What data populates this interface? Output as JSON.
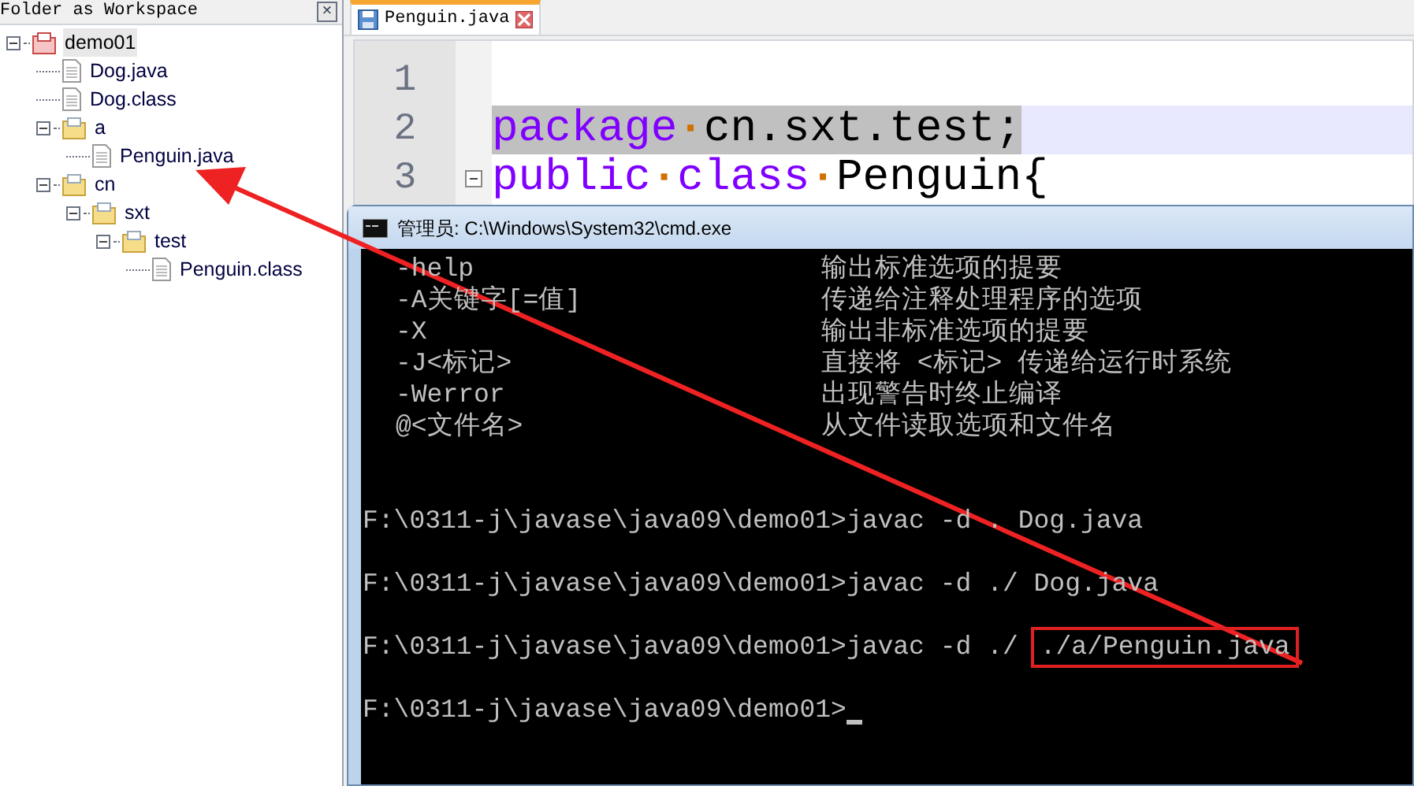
{
  "workspace_panel": {
    "title": "Folder as Workspace",
    "close_label": "×",
    "tree": [
      {
        "label": "demo01",
        "kind": "project",
        "expanded": true,
        "selected": true,
        "children": [
          {
            "label": "Dog.java",
            "kind": "file",
            "selected": false
          },
          {
            "label": "Dog.class",
            "kind": "file",
            "selected": false
          },
          {
            "label": "a",
            "kind": "folder",
            "expanded": true,
            "selected": false,
            "children": [
              {
                "label": "Penguin.java",
                "kind": "file",
                "selected": false
              }
            ]
          },
          {
            "label": "cn",
            "kind": "folder",
            "expanded": true,
            "selected": false,
            "children": [
              {
                "label": "sxt",
                "kind": "folder",
                "expanded": true,
                "selected": false,
                "children": [
                  {
                    "label": "test",
                    "kind": "folder",
                    "expanded": true,
                    "selected": false,
                    "children": [
                      {
                        "label": "Penguin.class",
                        "kind": "file",
                        "selected": false
                      }
                    ]
                  }
                ]
              }
            ]
          }
        ]
      }
    ]
  },
  "editor": {
    "tabs": [
      {
        "label": "Penguin.java",
        "selected": true
      }
    ],
    "lines": [
      {
        "number": "1",
        "current": false,
        "fold": false
      },
      {
        "number": "2",
        "current": true,
        "fold": false,
        "tokens": [
          {
            "kind": "keyword",
            "text": "package"
          },
          {
            "kind": "space",
            "text": "·"
          },
          {
            "kind": "plain",
            "text": "cn.sxt.test;"
          }
        ]
      },
      {
        "number": "3",
        "current": false,
        "fold": true,
        "tokens": [
          {
            "kind": "keyword",
            "text": "public"
          },
          {
            "kind": "space",
            "text": "·"
          },
          {
            "kind": "keyword",
            "text": "class"
          },
          {
            "kind": "space",
            "text": "·"
          },
          {
            "kind": "plain",
            "text": "Penguin{"
          }
        ]
      }
    ]
  },
  "console": {
    "title": "管理员: C:\\Windows\\System32\\cmd.exe",
    "help_options": [
      {
        "option": "-help",
        "description": "输出标准选项的提要"
      },
      {
        "option": "-A关键字[=值]",
        "description": "传递给注释处理程序的选项"
      },
      {
        "option": "-X",
        "description": "输出非标准选项的提要"
      },
      {
        "option": "-J<标记>",
        "description": "直接将 <标记> 传递给运行时系统"
      },
      {
        "option": "-Werror",
        "description": "出现警告时终止编译"
      },
      {
        "option": "@<文件名>",
        "description": "从文件读取选项和文件名"
      }
    ],
    "commands": [
      {
        "prompt": "F:\\0311-j\\javase\\java09\\demo01>",
        "command": "javac -d . Dog.java"
      },
      {
        "prompt": "F:\\0311-j\\javase\\java09\\demo01>",
        "command": "javac -d ./ Dog.java"
      },
      {
        "prompt": "F:\\0311-j\\javase\\java09\\demo01>",
        "command": "javac -d ./",
        "highlight": "./a/Penguin.java"
      },
      {
        "prompt": "F:\\0311-j\\javase\\java09\\demo01>",
        "cursor": true
      }
    ]
  }
}
